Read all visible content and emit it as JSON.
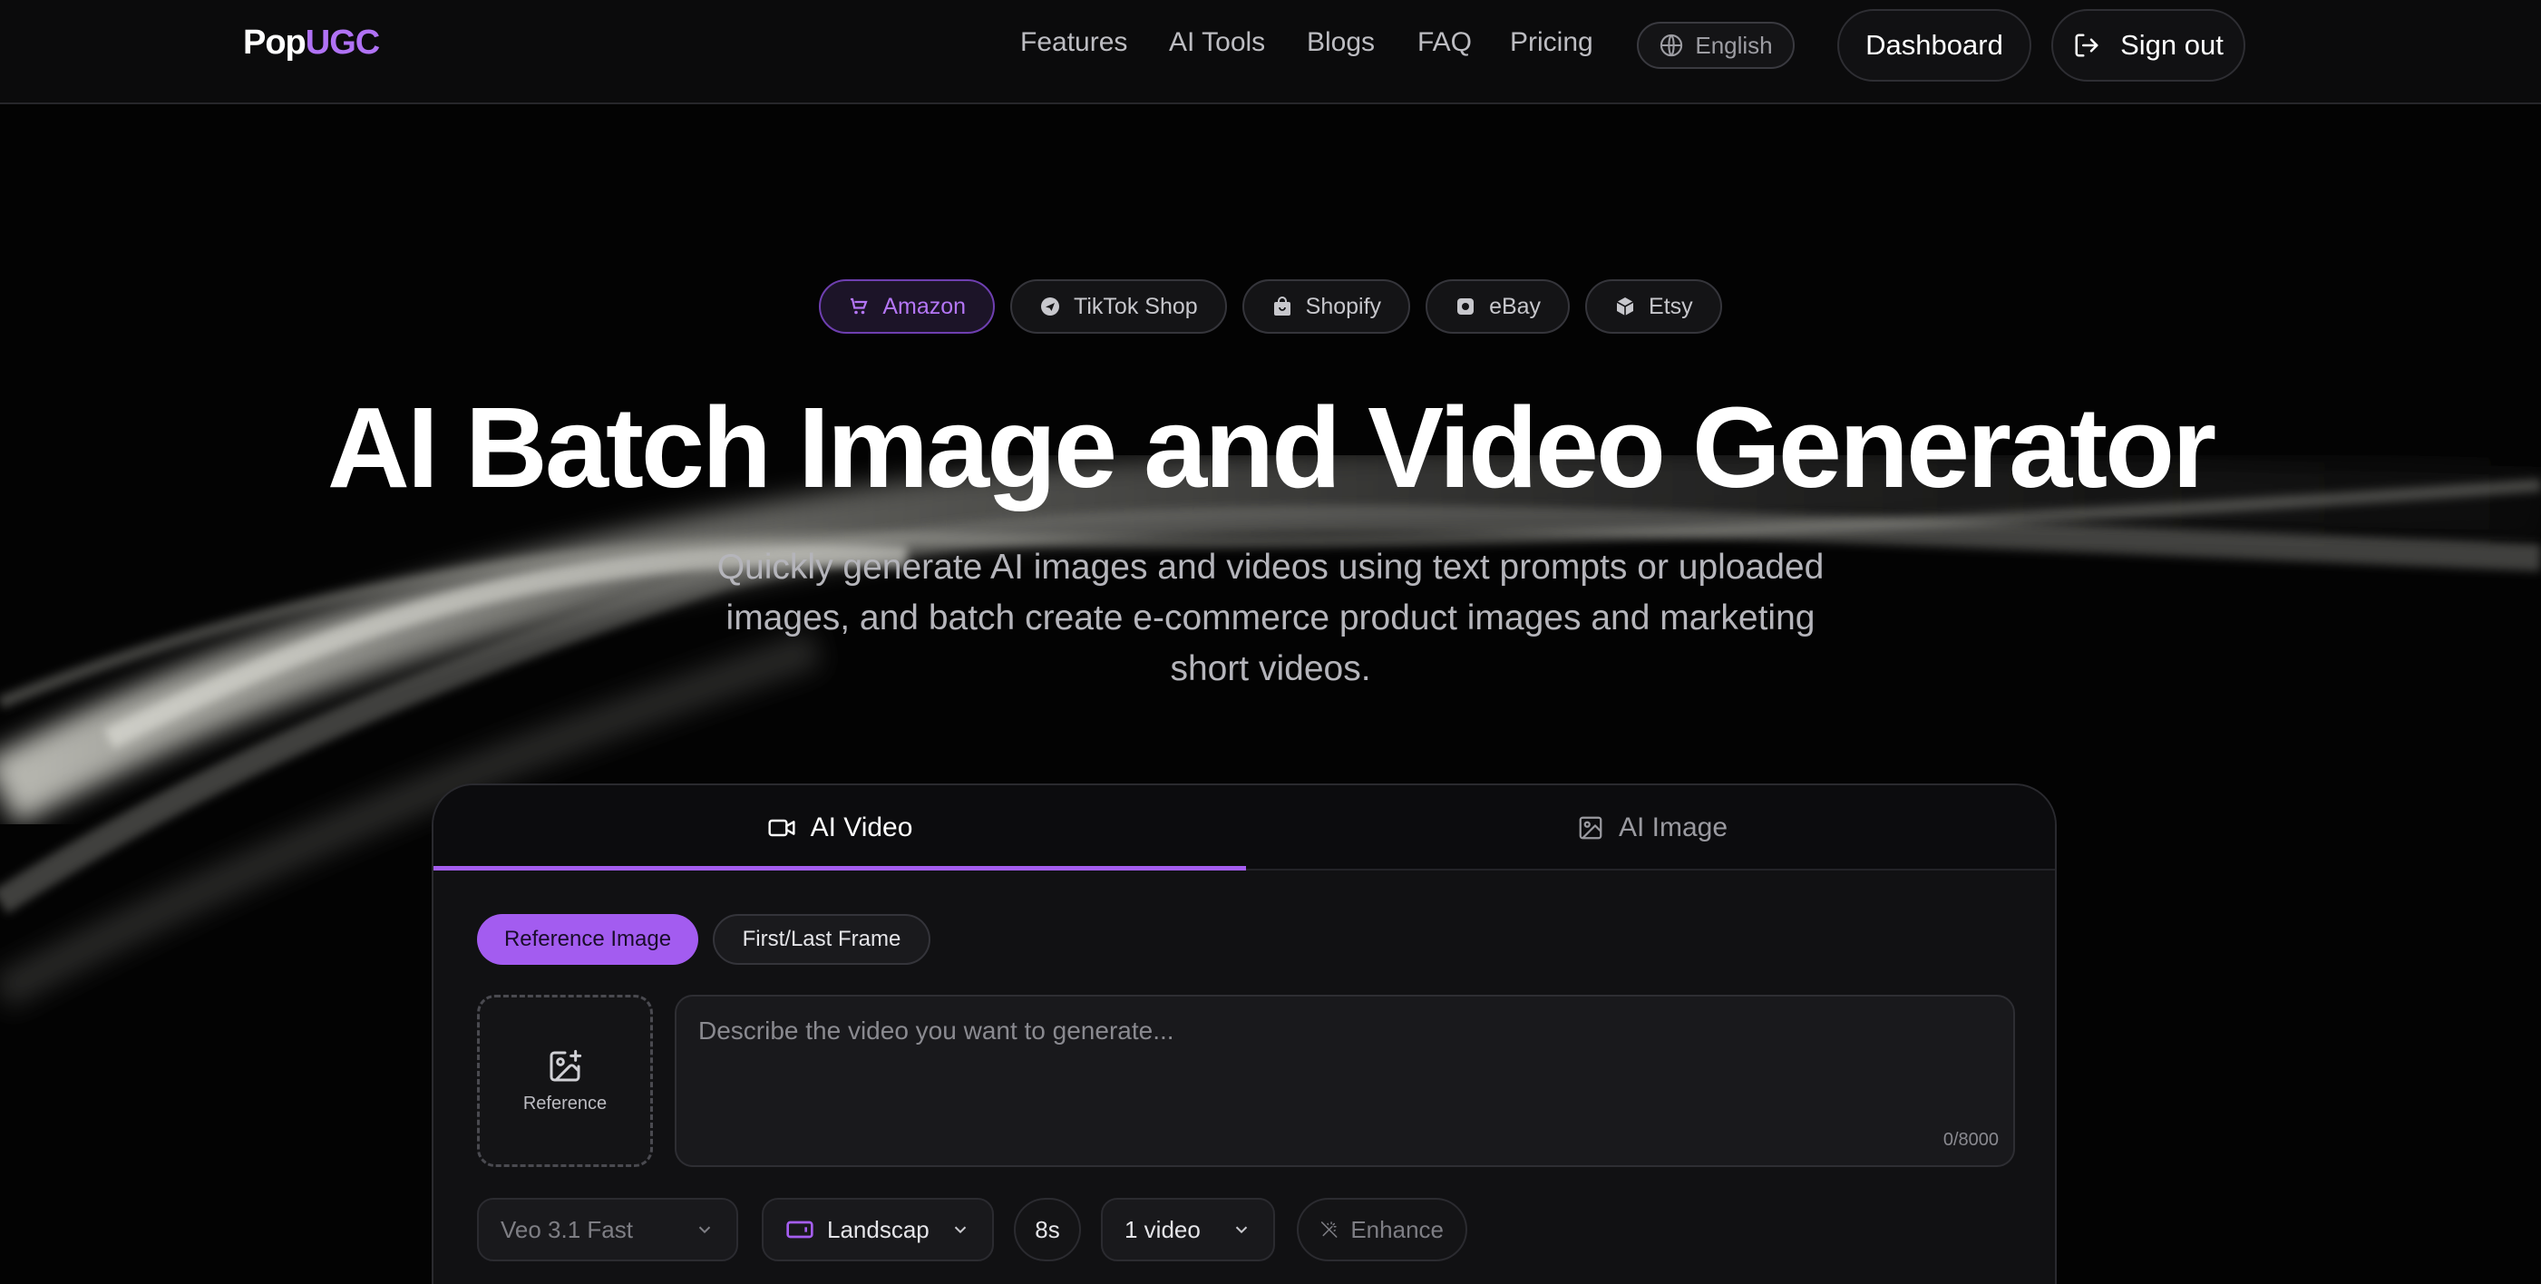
{
  "nav": {
    "logo_prefix": "Pop",
    "logo_suffix": "UGC",
    "links": [
      "Features",
      "AI Tools",
      "Blogs",
      "FAQ",
      "Pricing"
    ],
    "language": "English",
    "dashboard": "Dashboard",
    "sign_out": "Sign out"
  },
  "hero": {
    "platforms": [
      {
        "label": "Amazon",
        "icon": "cart-icon",
        "active": true
      },
      {
        "label": "TikTok Shop",
        "icon": "send-icon",
        "active": false
      },
      {
        "label": "Shopify",
        "icon": "shopping-bag-icon",
        "active": false
      },
      {
        "label": "eBay",
        "icon": "square-icon",
        "active": false
      },
      {
        "label": "Etsy",
        "icon": "box-icon",
        "active": false
      }
    ],
    "title": "AI Batch Image and Video Generator",
    "subtitle": "Quickly generate AI images and videos using text prompts or uploaded images, and batch create e-commerce product images and marketing short videos."
  },
  "generator": {
    "tabs": [
      {
        "label": "AI Video",
        "icon": "video-camera-icon",
        "active": true
      },
      {
        "label": "AI Image",
        "icon": "image-icon",
        "active": false
      }
    ],
    "modes": [
      {
        "label": "Reference Image",
        "active": true
      },
      {
        "label": "First/Last Frame",
        "active": false
      }
    ],
    "reference_label": "Reference",
    "prompt_placeholder": "Describe the video you want to generate...",
    "char_counter": "0/8000",
    "controls": {
      "model": "Veo 3.1 Fast",
      "orientation": "Landscap",
      "duration": "8s",
      "count": "1 video",
      "enhance": "Enhance"
    }
  },
  "colors": {
    "accent": "#a55ef0",
    "background": "#030303",
    "nav_background": "#0b0b0c"
  }
}
